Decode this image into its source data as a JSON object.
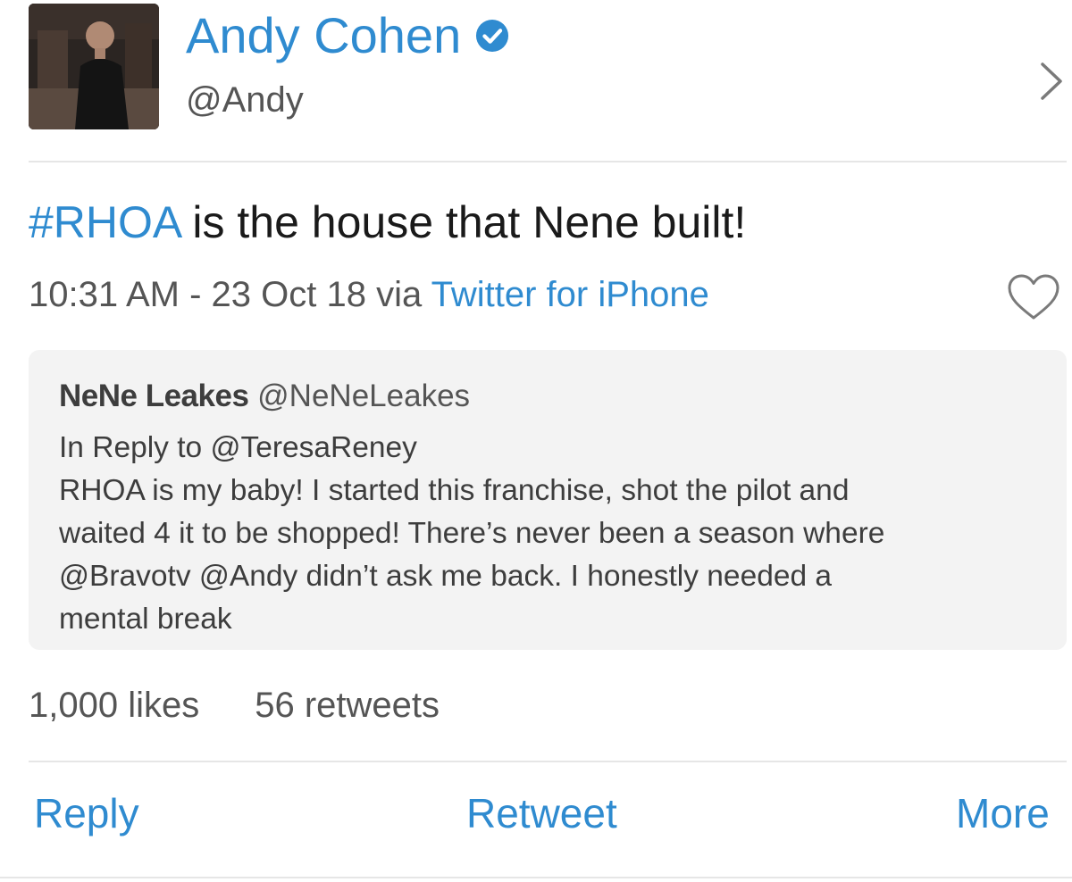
{
  "profile": {
    "display_name": "Andy Cohen",
    "handle": "@Andy",
    "verified": true
  },
  "tweet": {
    "hashtag": "#RHOA",
    "text": " is the house that Nene built!",
    "timestamp": "10:31 AM - 23 Oct 18 via ",
    "source": "Twitter for iPhone"
  },
  "quoted_tweet": {
    "author_name": "NeNe Leakes",
    "author_handle": "@NeNeLeakes",
    "lines": [
      "In Reply to @TeresaReney",
      "RHOA is my baby! I started this franchise, shot the pilot and",
      "waited 4 it to be shopped! There’s never been a season where",
      "@Bravotv @Andy didn’t ask me back. I honestly needed a",
      "mental break"
    ]
  },
  "stats": {
    "likes": "1,000 likes",
    "retweets": "56 retweets"
  },
  "actions": {
    "reply": "Reply",
    "retweet": "Retweet",
    "more": "More"
  },
  "colors": {
    "link": "#2f8bd0",
    "text": "#1a1a1a",
    "muted": "#555555",
    "quote_bg": "#f3f3f3",
    "divider": "#e6e6e6"
  },
  "icons": {
    "verified": "verified-badge-icon",
    "chevron": "chevron-right-icon",
    "like": "heart-icon"
  }
}
